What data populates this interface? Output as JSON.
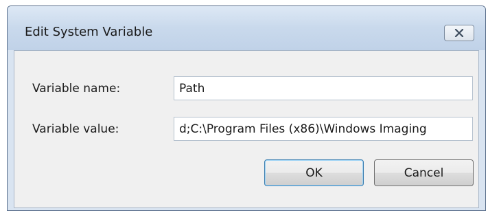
{
  "dialog": {
    "title": "Edit System Variable",
    "close_icon": "close-icon"
  },
  "fields": {
    "name_label": "Variable name:",
    "name_value": "Path",
    "value_label": "Variable value:",
    "value_value": "d;C:\\Program Files (x86)\\Windows Imaging"
  },
  "buttons": {
    "ok_label": "OK",
    "cancel_label": "Cancel"
  },
  "colors": {
    "titlebar": "#c9d9ec",
    "client_bg": "#f0f0f0",
    "ok_focus_border": "#3c7fb1"
  }
}
